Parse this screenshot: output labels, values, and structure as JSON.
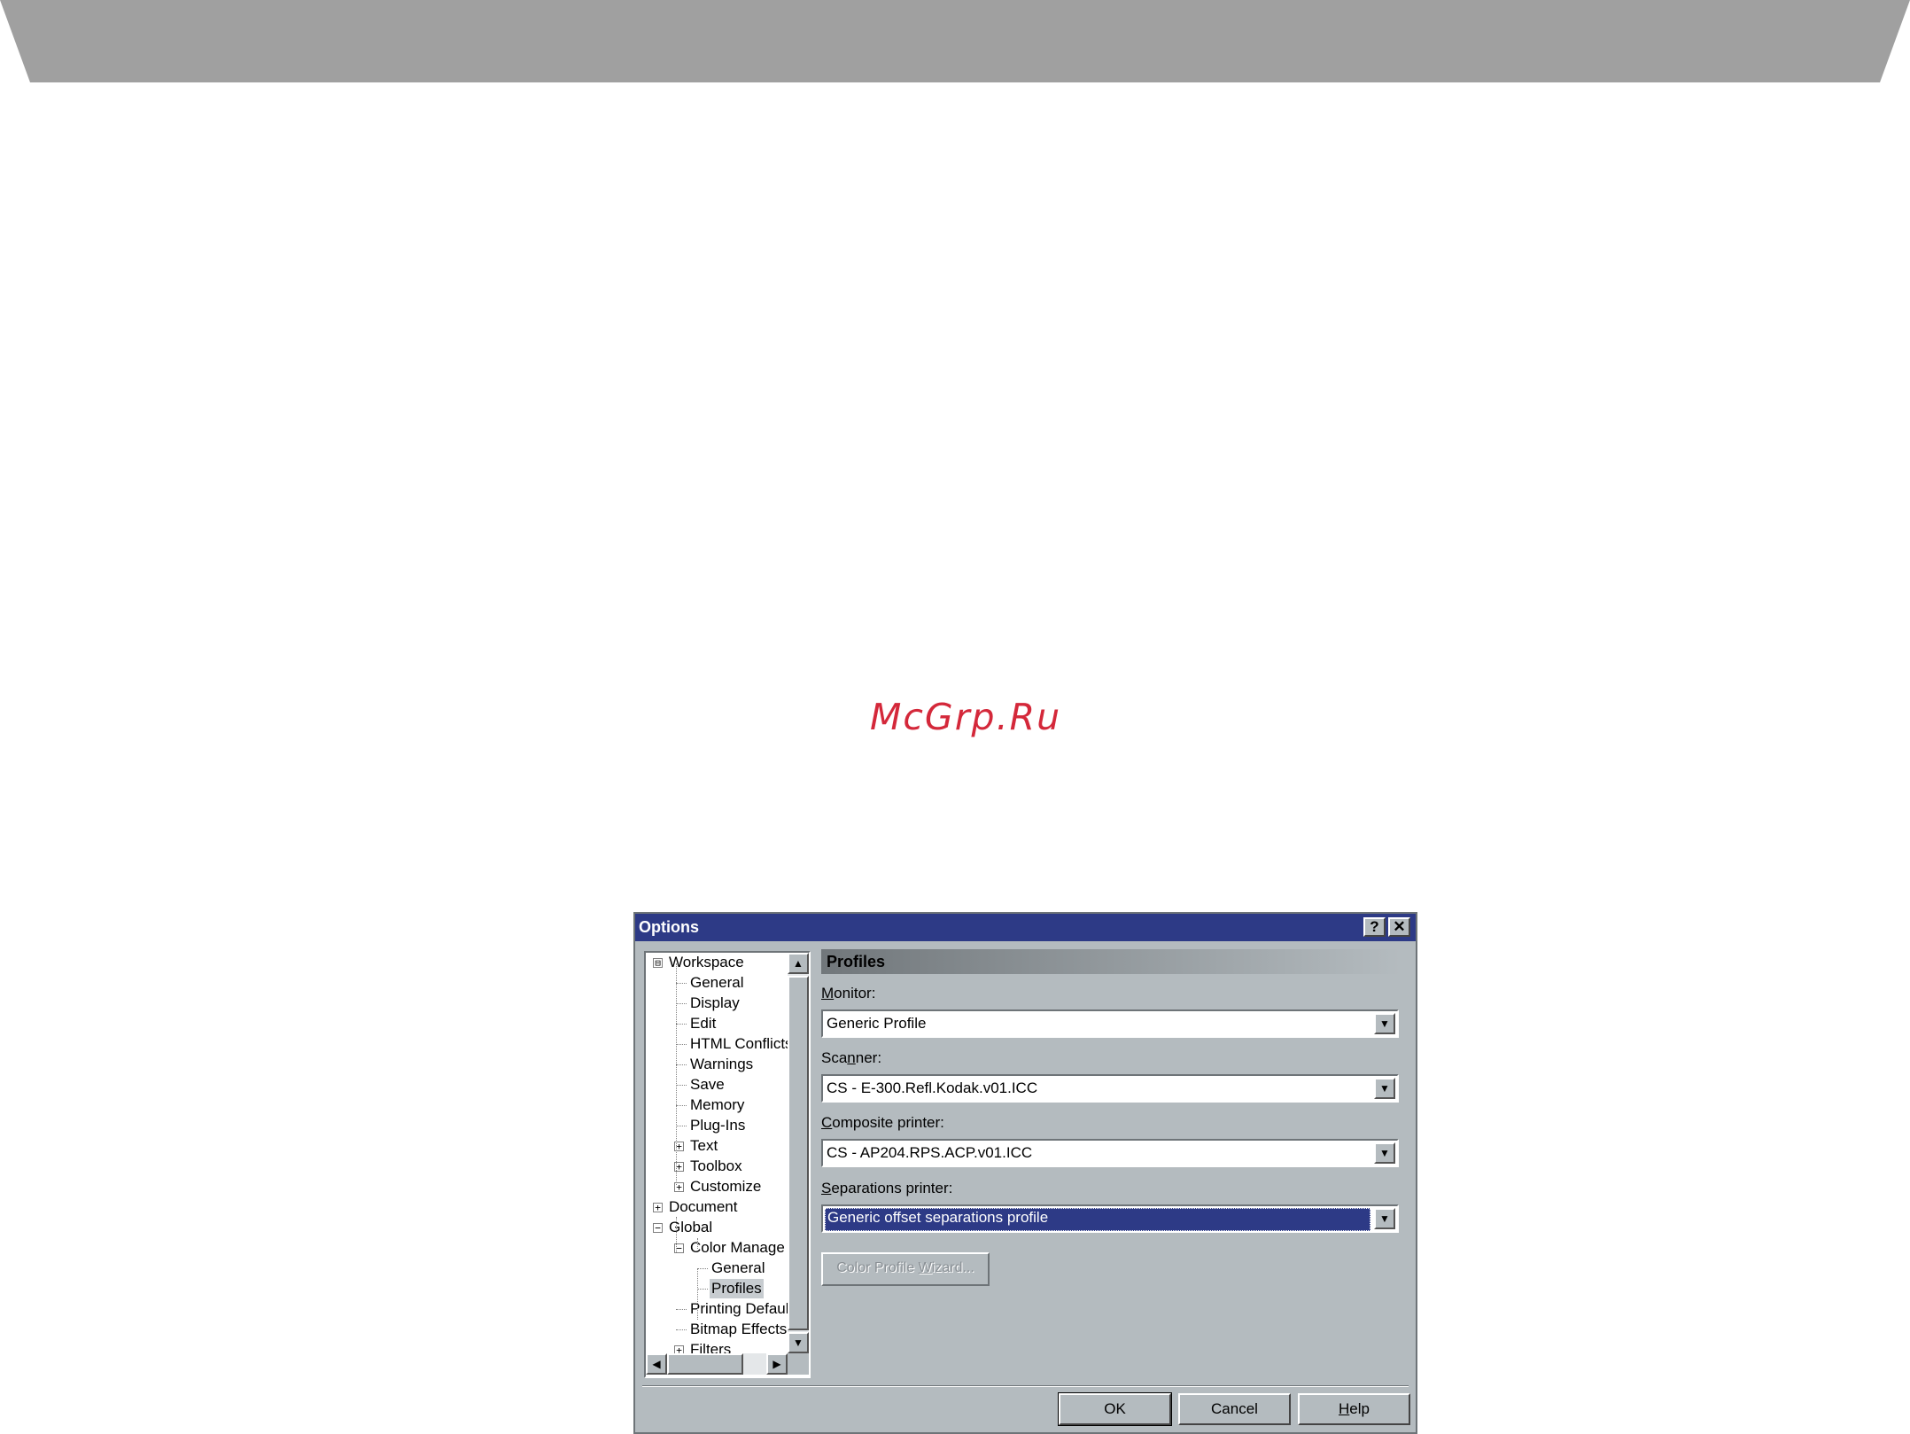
{
  "watermark": "McGrp.Ru",
  "dialog": {
    "title": "Options",
    "help_button": "?",
    "close_button": "✕",
    "tree": {
      "items": [
        {
          "label": "Workspace",
          "expander": "⊟"
        },
        {
          "label": "General"
        },
        {
          "label": "Display"
        },
        {
          "label": "Edit"
        },
        {
          "label": "HTML Conflicts"
        },
        {
          "label": "Warnings"
        },
        {
          "label": "Save"
        },
        {
          "label": "Memory"
        },
        {
          "label": "Plug-Ins"
        },
        {
          "label": "Text",
          "expander": "+"
        },
        {
          "label": "Toolbox",
          "expander": "+"
        },
        {
          "label": "Customize",
          "expander": "+"
        },
        {
          "label": "Document",
          "expander": "+"
        },
        {
          "label": "Global",
          "expander": "−"
        },
        {
          "label": "Color Manage",
          "expander": "−"
        },
        {
          "label": "General"
        },
        {
          "label": "Profiles",
          "selected": true
        },
        {
          "label": "Printing Defaul"
        },
        {
          "label": "Bitmap Effects"
        },
        {
          "label": "Filters",
          "expander": "+"
        }
      ]
    },
    "panel": {
      "header": "Profiles",
      "monitor": {
        "label_pre": "",
        "label_key": "M",
        "label_post": "onitor:",
        "value": "Generic Profile"
      },
      "scanner": {
        "label_pre": "Sca",
        "label_key": "n",
        "label_post": "ner:",
        "value": "CS - E-300.Refl.Kodak.v01.ICC"
      },
      "composite": {
        "label_pre": "",
        "label_key": "C",
        "label_post": "omposite printer:",
        "value": "CS - AP204.RPS.ACP.v01.ICC"
      },
      "separations": {
        "label_pre": "",
        "label_key": "S",
        "label_post": "eparations printer:",
        "value": "Generic offset separations profile"
      },
      "wizard_button": {
        "pre": "Color Profile ",
        "key": "W",
        "post": "izard..."
      }
    },
    "buttons": {
      "ok": "OK",
      "cancel": "Cancel",
      "help_pre": "",
      "help_key": "H",
      "help_post": "elp"
    }
  }
}
